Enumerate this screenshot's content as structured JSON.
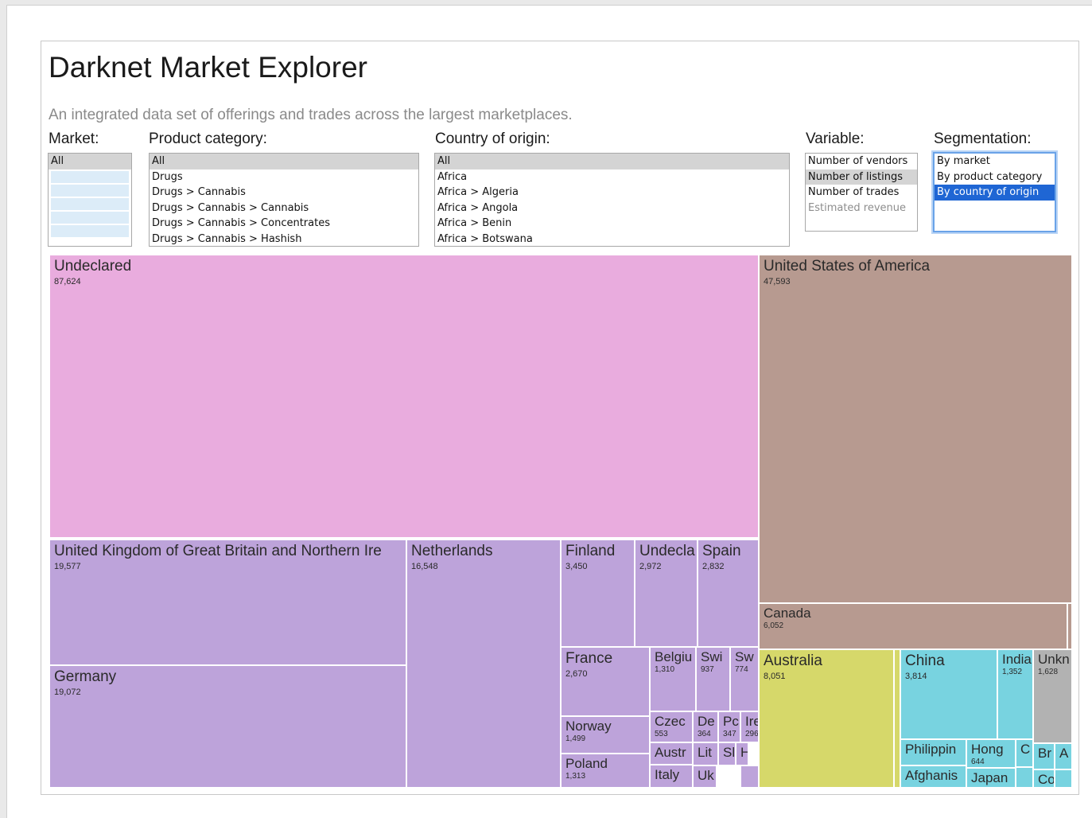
{
  "app": {
    "title": "Darknet Market Explorer",
    "subtitle": "An integrated data set of offerings and trades across the largest marketplaces."
  },
  "controls": {
    "market": {
      "label": "Market:",
      "options": [
        "All"
      ],
      "selected": "All"
    },
    "product_category": {
      "label": "Product category:",
      "options": [
        "All",
        "Drugs",
        "Drugs > Cannabis",
        "Drugs > Cannabis > Cannabis",
        "Drugs > Cannabis > Concentrates",
        "Drugs > Cannabis > Hashish"
      ],
      "selected": "All"
    },
    "country_of_origin": {
      "label": "Country of origin:",
      "options": [
        "All",
        "Africa",
        "Africa > Algeria",
        "Africa > Angola",
        "Africa > Benin",
        "Africa > Botswana"
      ],
      "selected": "All"
    },
    "variable": {
      "label": "Variable:",
      "options": [
        "Number of vendors",
        "Number of listings",
        "Number of trades",
        "Estimated revenue"
      ],
      "selected": "Number of listings",
      "disabled": [
        "Estimated revenue"
      ]
    },
    "segmentation": {
      "label": "Segmentation:",
      "options": [
        "By market",
        "By product category",
        "By country of origin"
      ],
      "selected": "By country of origin"
    }
  },
  "colors": {
    "undeclared": "#e9acde",
    "europe": "#bda3da",
    "north_america": "#b79a90",
    "oceania": "#d6d86a",
    "asia": "#78d3e0",
    "unknown": "#b2b2b2",
    "selected_option": "#1f66d4",
    "highlight_option": "#d4d4d4"
  },
  "chart_data": {
    "type": "treemap",
    "variable": "Number of listings",
    "segmentation": "By country of origin",
    "tiles": [
      {
        "name": "Undeclared",
        "value": 87624,
        "label": "87,624"
      },
      {
        "name": "United States of America",
        "value": 47593,
        "label": "47,593"
      },
      {
        "name": "United Kingdom of Great Britain and Northern Ire",
        "value": 19577,
        "label": "19,577"
      },
      {
        "name": "Germany",
        "value": 19072,
        "label": "19,072"
      },
      {
        "name": "Netherlands",
        "value": 16548,
        "label": "16,548"
      },
      {
        "name": "Australia",
        "value": 8051,
        "label": "8,051"
      },
      {
        "name": "Canada",
        "value": 6052,
        "label": "6,052"
      },
      {
        "name": "China",
        "value": 3814,
        "label": "3,814"
      },
      {
        "name": "Finland",
        "value": 3450,
        "label": "3,450"
      },
      {
        "name": "Undecla",
        "value": 2972,
        "label": "2,972"
      },
      {
        "name": "Spain",
        "value": 2832,
        "label": "2,832"
      },
      {
        "name": "France",
        "value": 2670,
        "label": "2,670"
      },
      {
        "name": "Unkn",
        "value": 1628,
        "label": "1,628"
      },
      {
        "name": "Norway",
        "value": 1499,
        "label": "1,499"
      },
      {
        "name": "India",
        "value": 1352,
        "label": "1,352"
      },
      {
        "name": "Poland",
        "value": 1313,
        "label": "1,313"
      },
      {
        "name": "Belgiu",
        "value": 1310,
        "label": "1,310"
      },
      {
        "name": "Swi",
        "value": 937,
        "label": "937"
      },
      {
        "name": "Sw",
        "value": 774,
        "label": "774"
      },
      {
        "name": "Hong",
        "value": 644,
        "label": "644"
      },
      {
        "name": "Czec",
        "value": 553,
        "label": "553"
      },
      {
        "name": "De",
        "value": 364,
        "label": "364"
      },
      {
        "name": "Pc",
        "value": 347,
        "label": "347"
      },
      {
        "name": "Ire",
        "value": 296,
        "label": "296"
      },
      {
        "name": "Philippin",
        "value": null,
        "label": ""
      },
      {
        "name": "Afghanis",
        "value": null,
        "label": ""
      },
      {
        "name": "Japan",
        "value": null,
        "label": ""
      },
      {
        "name": "Austr",
        "value": null,
        "label": ""
      },
      {
        "name": "Italy",
        "value": null,
        "label": ""
      },
      {
        "name": "Lit",
        "value": null,
        "label": ""
      },
      {
        "name": "Sl",
        "value": null,
        "label": ""
      },
      {
        "name": "H",
        "value": null,
        "label": ""
      },
      {
        "name": "Uk",
        "value": null,
        "label": ""
      },
      {
        "name": "Br",
        "value": null,
        "label": ""
      },
      {
        "name": "A",
        "value": null,
        "label": ""
      },
      {
        "name": "Co",
        "value": null,
        "label": ""
      },
      {
        "name": "C",
        "value": null,
        "label": ""
      }
    ]
  }
}
